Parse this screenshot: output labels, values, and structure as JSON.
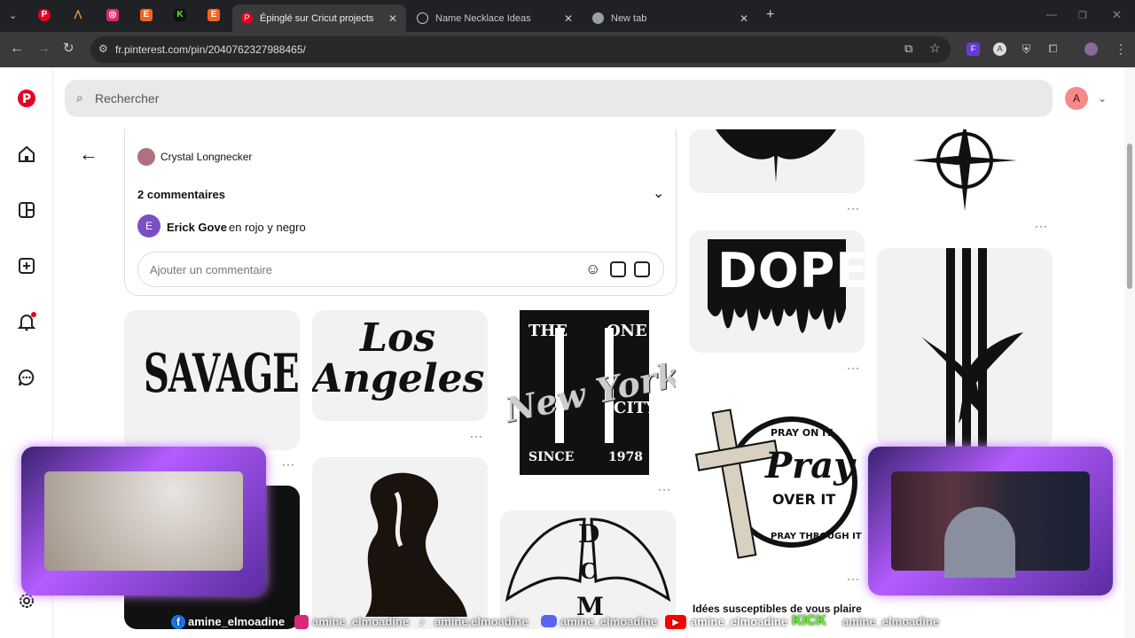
{
  "browser": {
    "tabs": [
      {
        "label": "",
        "icon": "pinterest-icon"
      },
      {
        "label": "",
        "icon": "m-logo-icon"
      },
      {
        "label": "",
        "icon": "instagram-icon"
      },
      {
        "label": "",
        "icon": "etsy-icon"
      },
      {
        "label": "",
        "icon": "kick-icon"
      },
      {
        "label": "",
        "icon": "etsy-icon"
      },
      {
        "label": "Épinglé sur Cricut projects",
        "icon": "pinterest-icon"
      },
      {
        "label": "Name Necklace Ideas",
        "icon": "chatgpt-icon"
      },
      {
        "label": "New tab",
        "icon": "chrome-icon"
      }
    ],
    "url": "fr.pinterest.com/pin/2040762327988465/"
  },
  "search": {
    "placeholder": "Rechercher"
  },
  "user": {
    "initial": "A"
  },
  "pin": {
    "author": "Crystal Longnecker",
    "comments_header": "2 commentaires",
    "comment": {
      "initial": "E",
      "author": "Erick Gove",
      "text": "en rojo y negro"
    },
    "add_comment_placeholder": "Ajouter un commentaire"
  },
  "grid": {
    "savage": "SAVAGE",
    "los": "Los",
    "angeles": "Angeles",
    "the": "THE",
    "one": "ONE",
    "newyork": "New York",
    "city": "CITY",
    "since": "SINCE",
    "year": "1978",
    "dope": "DOPE",
    "pray_top": "PRAY ON IT",
    "pray": "Pray",
    "over": "OVER IT",
    "pray_bottom": "PRAY THROUGH IT",
    "d": "D",
    "c": "C",
    "m": "M",
    "more": "···",
    "ideas_title": "Idées susceptibles de vous plaire"
  },
  "stream": {
    "facebook": "amine_elmoadine",
    "instagram": "amine_elmoadine",
    "tiktok": "amine.elmoadine",
    "discord": "amine_elmoadine",
    "youtube": "amine_elmoadine",
    "kick_label": "KICK",
    "kick": "amine_elmoadine"
  }
}
